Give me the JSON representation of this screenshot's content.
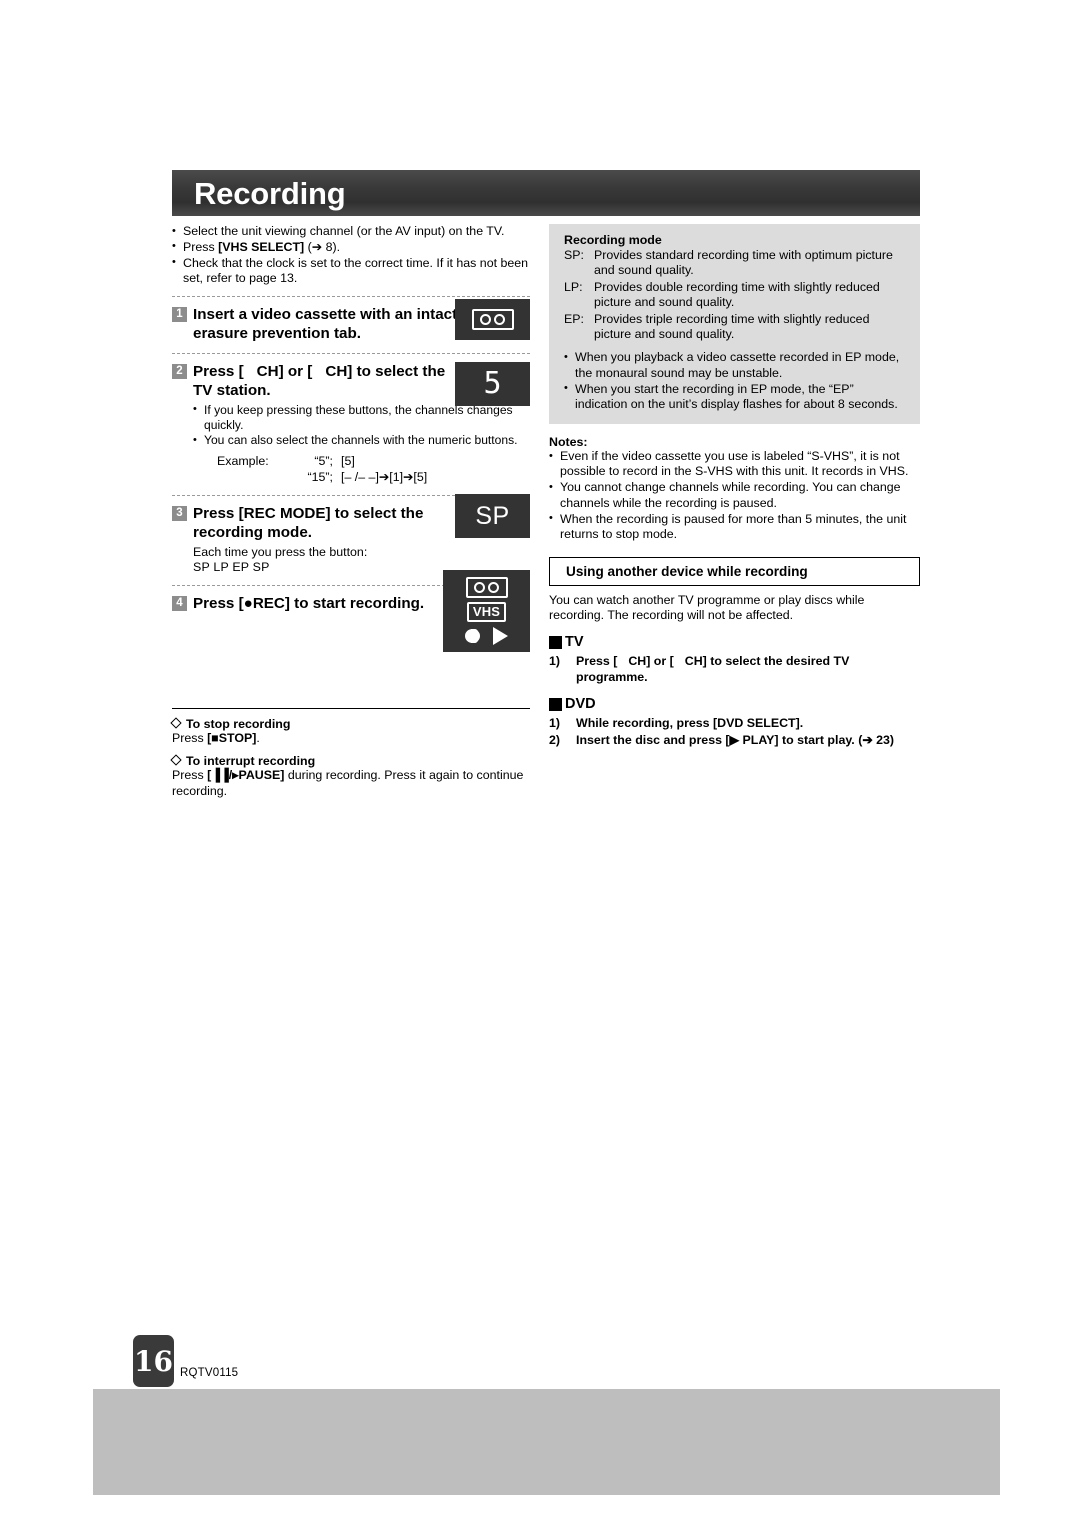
{
  "header": {
    "title": "Recording"
  },
  "left": {
    "intro_bullets": [
      "Select the unit viewing channel (or the AV input) on the TV.",
      "Press [VHS SELECT] (➔ 8).",
      "Check that the clock is set to the correct time. If it has not been set, refer to page 13."
    ],
    "intro_bullet2_pre": "Press ",
    "intro_bullet2_key": "[VHS SELECT]",
    "intro_bullet2_post": " (➔ 8).",
    "steps": [
      {
        "num": "1",
        "title": "Insert a video cassette with an intact erasure prevention tab.",
        "bullets": []
      },
      {
        "num": "2",
        "title_pre": "Press [",
        "title_mid": "CH] or [",
        "title_post": "CH] to select the TV station.",
        "title": "Press [ CH] or [ CH] to select the TV station.",
        "bullets": [
          "If you keep pressing these buttons, the channels changes quickly.",
          "You can also select the channels with the numeric buttons."
        ],
        "example_label": "Example:",
        "example_rows": [
          {
            "quote": "“5”;",
            "keys": "[5]"
          },
          {
            "quote": "“15”;",
            "keys": "[– /– –]➔[1]➔[5]"
          }
        ]
      },
      {
        "num": "3",
        "title": "Press [REC MODE] to select the recording mode.",
        "sub_line": "Each time you press the button:",
        "mode_sequence": "SP    LP    EP    SP"
      },
      {
        "num": "4",
        "title": "Press [●REC] to start recording."
      }
    ],
    "stop_section": {
      "heading": "To stop recording",
      "text_pre": "Press ",
      "text_key": "[■STOP]",
      "text_post": "."
    },
    "interrupt_section": {
      "heading": "To interrupt recording",
      "text_pre": "Press ",
      "text_key": "[▐▐/▸PAUSE]",
      "text_post": " during recording. Press it again to continue recording."
    }
  },
  "panels": {
    "cassette_label": "cassette-display",
    "channel_digit": "5",
    "rec_mode_text": "SP",
    "vhs_label": "VHS"
  },
  "right": {
    "recording_mode_box": {
      "title": "Recording mode",
      "modes": [
        {
          "key": "SP:",
          "def": "Provides standard recording time with optimum picture and sound quality."
        },
        {
          "key": "LP:",
          "def": "Provides double recording time with slightly reduced picture and sound quality."
        },
        {
          "key": "EP:",
          "def": "Provides triple recording time with slightly reduced picture and sound quality."
        }
      ],
      "bullets": [
        "When you playback a video cassette recorded in EP mode, the monaural sound may be unstable.",
        "When you start the recording in EP mode, the “EP” indication on the unit’s display flashes for about 8 seconds."
      ]
    },
    "notes": {
      "title": "Notes:",
      "bullets": [
        "Even if the video cassette you use is labeled “S-VHS”, it is not possible to record in the S-VHS with this unit. It records in VHS.",
        "You cannot change channels while recording. You can change channels while the recording is paused.",
        "When the recording is paused for more than 5 minutes, the unit returns to stop mode."
      ]
    },
    "another_device": {
      "title": "Using another device while recording",
      "intro": "You can watch another TV programme or play discs while recording. The recording will not be affected.",
      "tv": {
        "heading": "TV",
        "steps": [
          {
            "num": "1)",
            "text": "Press [ CH] or [ CH] to select the desired TV programme."
          }
        ]
      },
      "dvd": {
        "heading": "DVD",
        "steps": [
          {
            "num": "1)",
            "text": "While recording, press [DVD SELECT]."
          },
          {
            "num": "2)",
            "text": "Insert the disc and press [▶ PLAY] to start play. (➔ 23)"
          }
        ]
      }
    }
  },
  "footer": {
    "page_number": "16",
    "document_code": "RQTV0115"
  }
}
